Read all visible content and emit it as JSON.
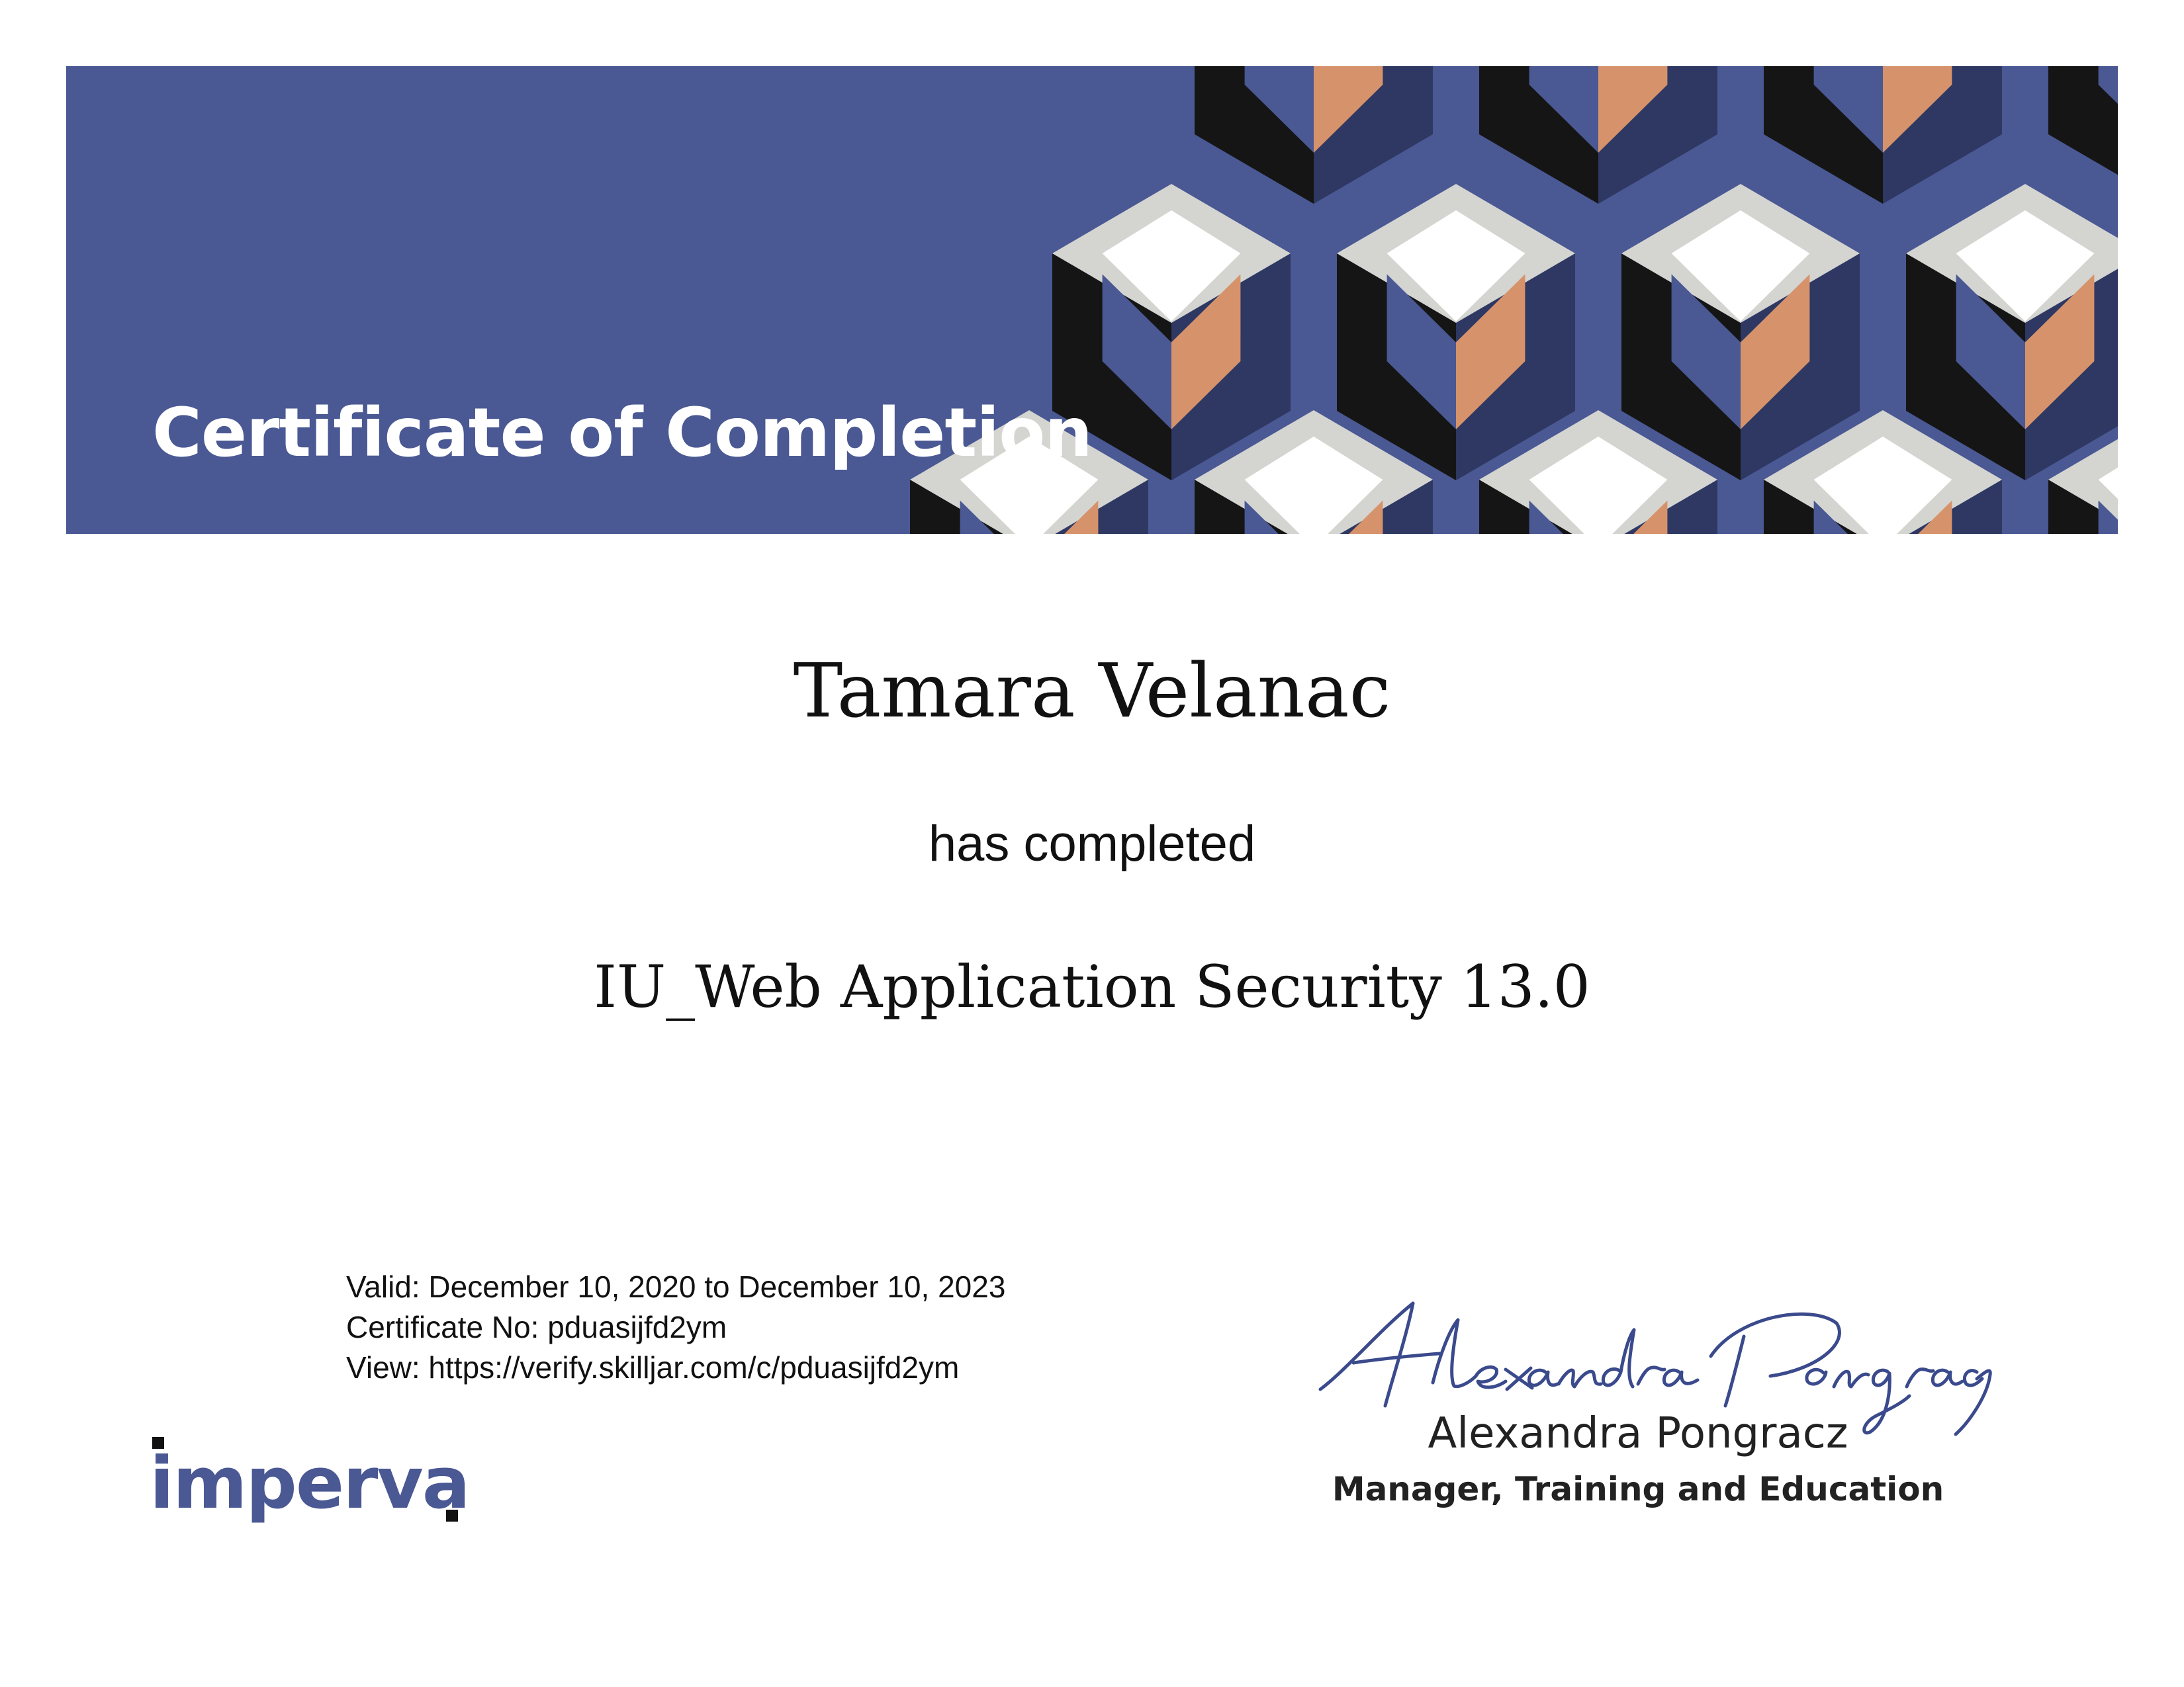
{
  "banner": {
    "title": "Certificate of Completion",
    "colors": {
      "background": "#4a5893",
      "cube_top": "#d4d5d1",
      "cube_top_inner": "#ffffff",
      "cube_left_dark": "#151515",
      "cube_right_shade": "#2e3862",
      "cube_inner_face": "#4a5893",
      "cube_accent": "#d6936b"
    }
  },
  "recipient": {
    "name": "Tamara Velanac"
  },
  "statement": {
    "text": "has completed"
  },
  "course": {
    "name": "IU_Web Application Security 13.0"
  },
  "details": {
    "valid": "Valid: December 10, 2020 to December 10, 2023",
    "certificate_no": "Certificate No: pduasijfd2ym",
    "view": "View: https://verify.skilljar.com/c/pduasijfd2ym"
  },
  "logo": {
    "text": "imperva",
    "icon": "imperva-logo",
    "color": "#4a5893"
  },
  "signature": {
    "icon": "handwritten-signature",
    "script_text": "Alexandra Pongracz",
    "name": "Alexandra Pongracz",
    "title": "Manager, Training and Education",
    "ink_color": "#3a4a8c"
  }
}
